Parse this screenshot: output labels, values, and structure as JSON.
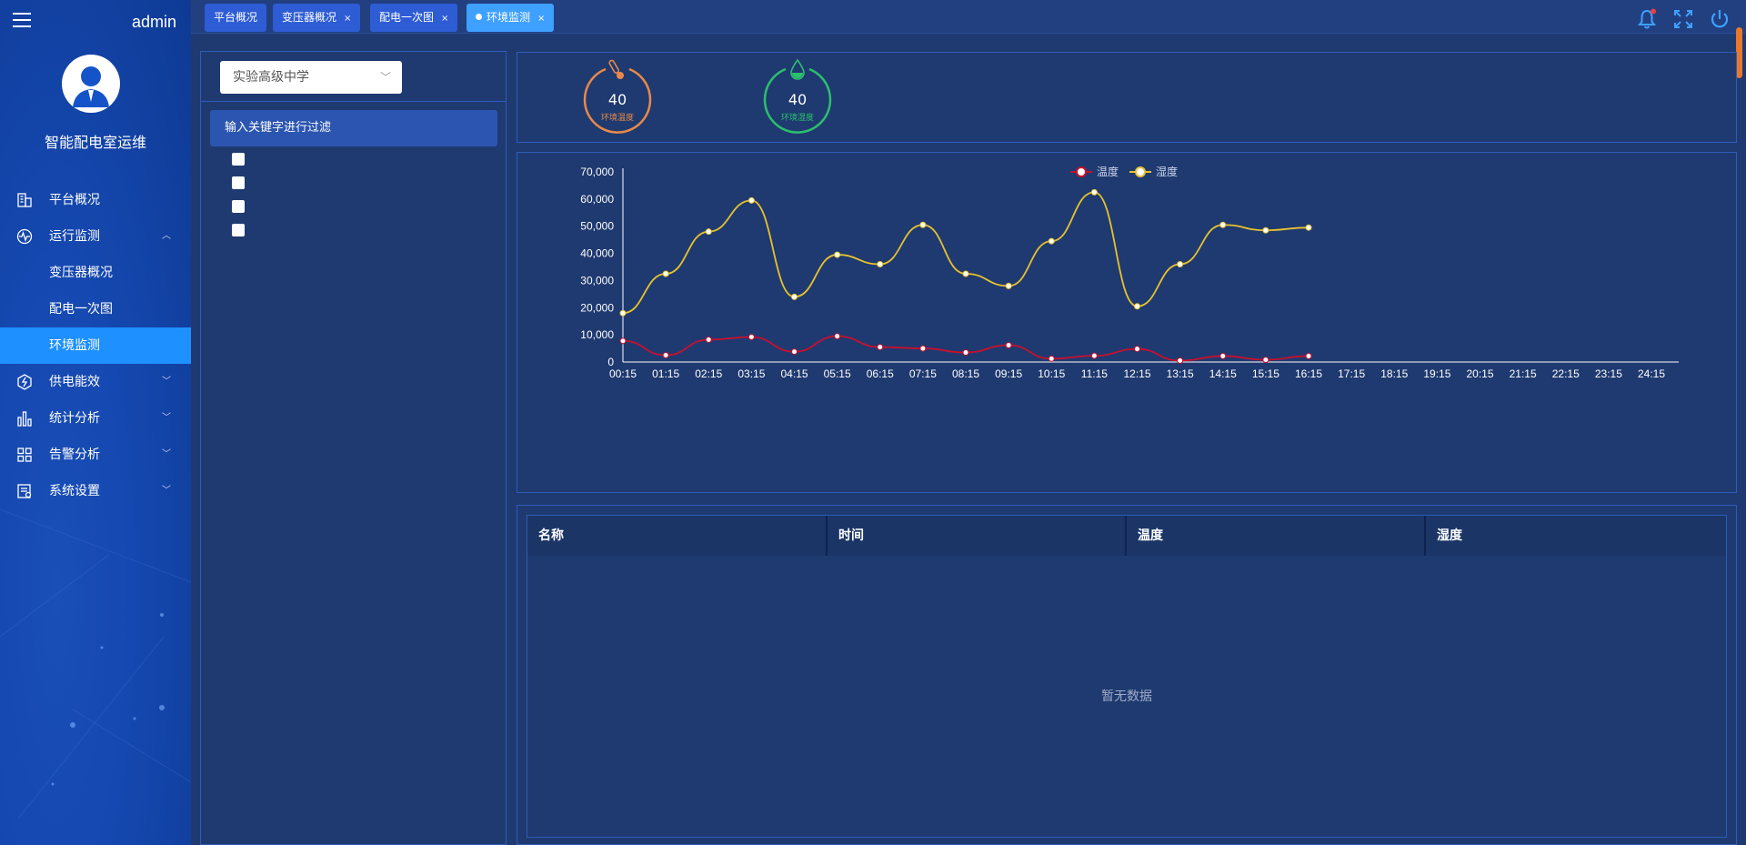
{
  "sidebar": {
    "user": "admin",
    "system_title": "智能配电室运维",
    "menu": [
      {
        "label": "平台概况",
        "icon": "building-icon"
      },
      {
        "label": "运行监测",
        "icon": "pulse-icon",
        "expanded": true,
        "children": [
          {
            "label": "变压器概况"
          },
          {
            "label": "配电一次图"
          },
          {
            "label": "环境监测",
            "active": true
          }
        ]
      },
      {
        "label": "供电能效",
        "icon": "energy-icon"
      },
      {
        "label": "统计分析",
        "icon": "bar-chart-icon"
      },
      {
        "label": "告警分析",
        "icon": "grid-icon"
      },
      {
        "label": "系统设置",
        "icon": "settings-doc-icon"
      }
    ]
  },
  "tabs": [
    {
      "label": "平台概况",
      "closable": false
    },
    {
      "label": "变压器概况",
      "closable": true
    },
    {
      "label": "配电一次图",
      "closable": true
    },
    {
      "label": "环境监测",
      "closable": true,
      "active": true
    }
  ],
  "tab_close": "×",
  "left": {
    "select_value": "实验高级中学",
    "filter_placeholder": "输入关键字进行过滤",
    "checkbox_count": 4
  },
  "gauges": [
    {
      "value": "40",
      "label": "环境温度",
      "color": "#e8894a",
      "icon": "thermometer-icon"
    },
    {
      "value": "40",
      "label": "环境湿度",
      "color": "#2cbf6e",
      "icon": "water-drop-icon"
    }
  ],
  "chart_data": {
    "type": "line",
    "title": "",
    "xlabel": "",
    "ylabel": "",
    "ylim": [
      0,
      70000
    ],
    "yticks": [
      "0",
      "10,000",
      "20,000",
      "30,000",
      "40,000",
      "50,000",
      "60,000",
      "70,000"
    ],
    "x": [
      "00:15",
      "01:15",
      "02:15",
      "03:15",
      "04:15",
      "05:15",
      "06:15",
      "07:15",
      "08:15",
      "09:15",
      "10:15",
      "11:15",
      "12:15",
      "13:15",
      "14:15",
      "15:15",
      "16:15",
      "17:15",
      "18:15",
      "19:15",
      "20:15",
      "21:15",
      "22:15",
      "23:15",
      "24:15"
    ],
    "legend_position": "top-center",
    "series": [
      {
        "name": "温度",
        "color": "#c8102e",
        "values": [
          7800,
          2500,
          8200,
          9200,
          3800,
          9500,
          5500,
          5000,
          3500,
          6200,
          1200,
          2300,
          4800,
          500,
          2200,
          800,
          2200,
          null,
          null,
          null,
          null,
          null,
          null,
          null,
          null
        ]
      },
      {
        "name": "湿度",
        "color": "#e8c22e",
        "values": [
          18000,
          32500,
          48000,
          59500,
          24000,
          39500,
          36000,
          50500,
          32500,
          28000,
          44500,
          62500,
          20500,
          36000,
          50500,
          48500,
          49500,
          null,
          null,
          null,
          null,
          null,
          null,
          null,
          null
        ]
      }
    ]
  },
  "table": {
    "columns": [
      "名称",
      "时间",
      "温度",
      "湿度"
    ],
    "empty_text": "暂无数据"
  }
}
